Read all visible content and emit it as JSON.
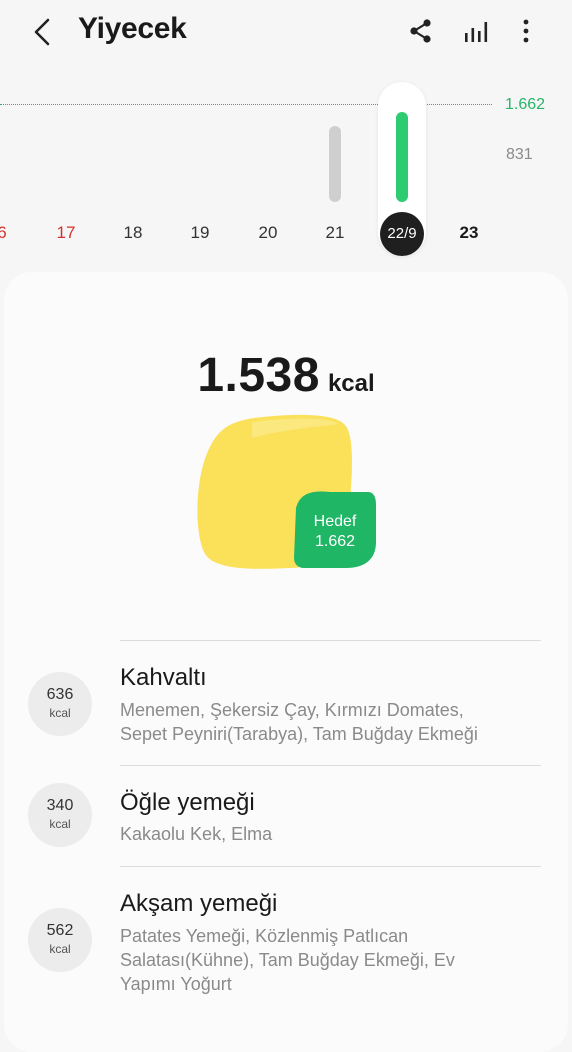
{
  "header": {
    "title": "Yiyecek",
    "icons": [
      "back-arrow-icon",
      "share-icon",
      "trend-chart-icon",
      "more-vertical-icon"
    ]
  },
  "chart": {
    "goal_label": "1.662",
    "half_label": "831",
    "days": [
      {
        "label": "6",
        "style": "red"
      },
      {
        "label": "17",
        "style": "red"
      },
      {
        "label": "18",
        "style": "normal"
      },
      {
        "label": "19",
        "style": "normal"
      },
      {
        "label": "20",
        "style": "normal"
      },
      {
        "label": "21",
        "style": "normal"
      },
      {
        "label": "22/9",
        "style": "selected"
      },
      {
        "label": "23",
        "style": "bold"
      }
    ],
    "colors": {
      "goal": "#27b56a",
      "bar_selected": "#2ecc71",
      "bar_other": "#cfcfcf"
    }
  },
  "summary": {
    "total_value": "1.538",
    "total_unit": "kcal",
    "goal_label": "Hedef",
    "goal_value": "1.662",
    "colors": {
      "blob": "#fbe05a",
      "goal_badge": "#1fb665"
    }
  },
  "meals": [
    {
      "kcal": "636",
      "unit": "kcal",
      "name": "Kahvaltı",
      "items_line1": "Menemen, Şekersiz Çay, Kırmızı Domates,",
      "items_line2": "Sepet Peyniri(Tarabya), Tam Buğday Ekmeği",
      "items_line3": ""
    },
    {
      "kcal": "340",
      "unit": "kcal",
      "name": "Öğle yemeği",
      "items_line1": "Kakaolu Kek, Elma",
      "items_line2": "",
      "items_line3": ""
    },
    {
      "kcal": "562",
      "unit": "kcal",
      "name": "Akşam yemeği",
      "items_line1": "Patates Yemeği, Közlenmiş Patlıcan",
      "items_line2": "Salatası(Kühne), Tam Buğday Ekmeği, Ev",
      "items_line3": "Yapımı Yoğurt"
    }
  ]
}
